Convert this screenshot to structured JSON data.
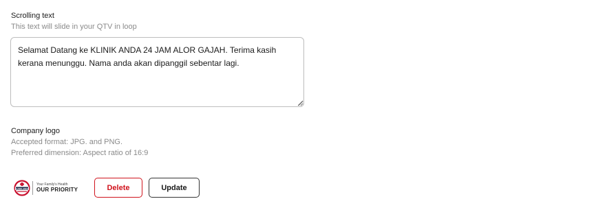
{
  "scrolling_text": {
    "label": "Scrolling text",
    "hint": "This text will slide in your QTV in loop",
    "value": "Selamat Datang ke KLINIK ANDA 24 JAM ALOR GAJAH. Terima kasih kerana menunggu. Nama anda akan dipanggil sebentar lagi."
  },
  "company_logo": {
    "label": "Company logo",
    "format_hint": "Accepted format: JPG. and PNG.",
    "dimension_hint": "Preferred dimension: Aspect ratio of 16:9",
    "logo_tagline_small": "Your Family's Health",
    "logo_tagline_big": "OUR PRIORITY",
    "logo_mark_text": "KLINIK ANDA",
    "brand_color": "#c8102e"
  },
  "actions": {
    "delete_label": "Delete",
    "update_label": "Update",
    "delete_color": "#d0121b"
  }
}
